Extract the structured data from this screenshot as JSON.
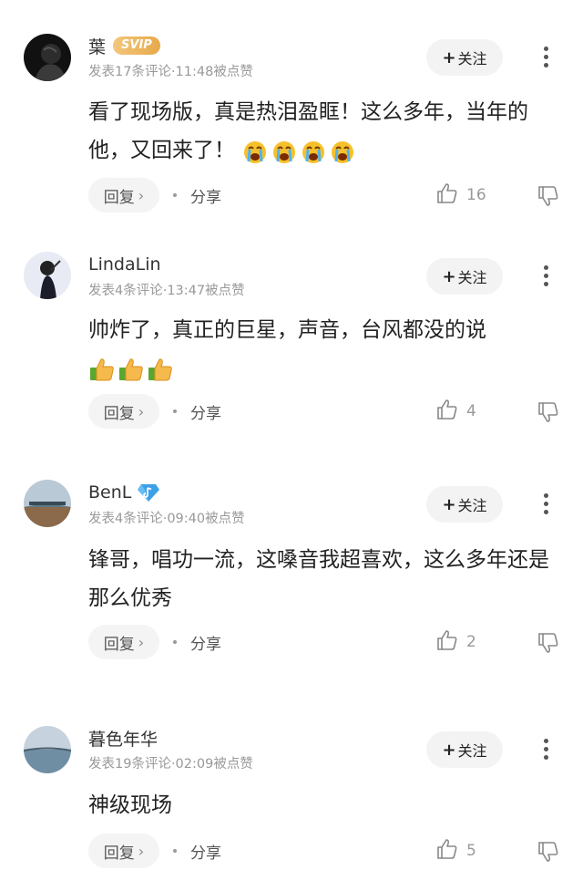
{
  "comments": [
    {
      "username": "葉",
      "badge": "SVIP",
      "meta": "发表17条评论·11:48被点赞",
      "text": "看了现场版，真是热泪盈眶！这么多年，当年的他，又回来了！",
      "emojis": [
        "crying-face",
        "crying-face",
        "crying-face",
        "crying-face"
      ],
      "follow_label": "关注",
      "reply_label": "回复",
      "share_label": "分享",
      "likes": "16"
    },
    {
      "username": "LindaLin",
      "meta": "发表4条评论·13:47被点赞",
      "text": "帅炸了，真正的巨星，声音，台风都没的说",
      "emojis": [
        "thumbs-up",
        "thumbs-up",
        "thumbs-up"
      ],
      "follow_label": "关注",
      "reply_label": "回复",
      "share_label": "分享",
      "likes": "4"
    },
    {
      "username": "BenL",
      "badge": "diamond-music",
      "meta": "发表4条评论·09:40被点赞",
      "text": "锋哥，唱功一流，这嗓音我超喜欢，这么多年还是那么优秀",
      "follow_label": "关注",
      "reply_label": "回复",
      "share_label": "分享",
      "likes": "2"
    },
    {
      "username": "暮色年华",
      "meta": "发表19条评论·02:09被点赞",
      "text": "神级现场",
      "follow_label": "关注",
      "reply_label": "回复",
      "share_label": "分享",
      "likes": "5"
    }
  ],
  "icons": {
    "like": "thumbs-up-outline-icon",
    "dislike": "thumbs-down-outline-icon",
    "more": "vertical-ellipsis-icon",
    "reply_chevron": "chevron-right-icon"
  },
  "colors": {
    "svip_gold": "#e9ae52",
    "follow_bg": "#f3f3f3",
    "meta_text": "#999999"
  }
}
